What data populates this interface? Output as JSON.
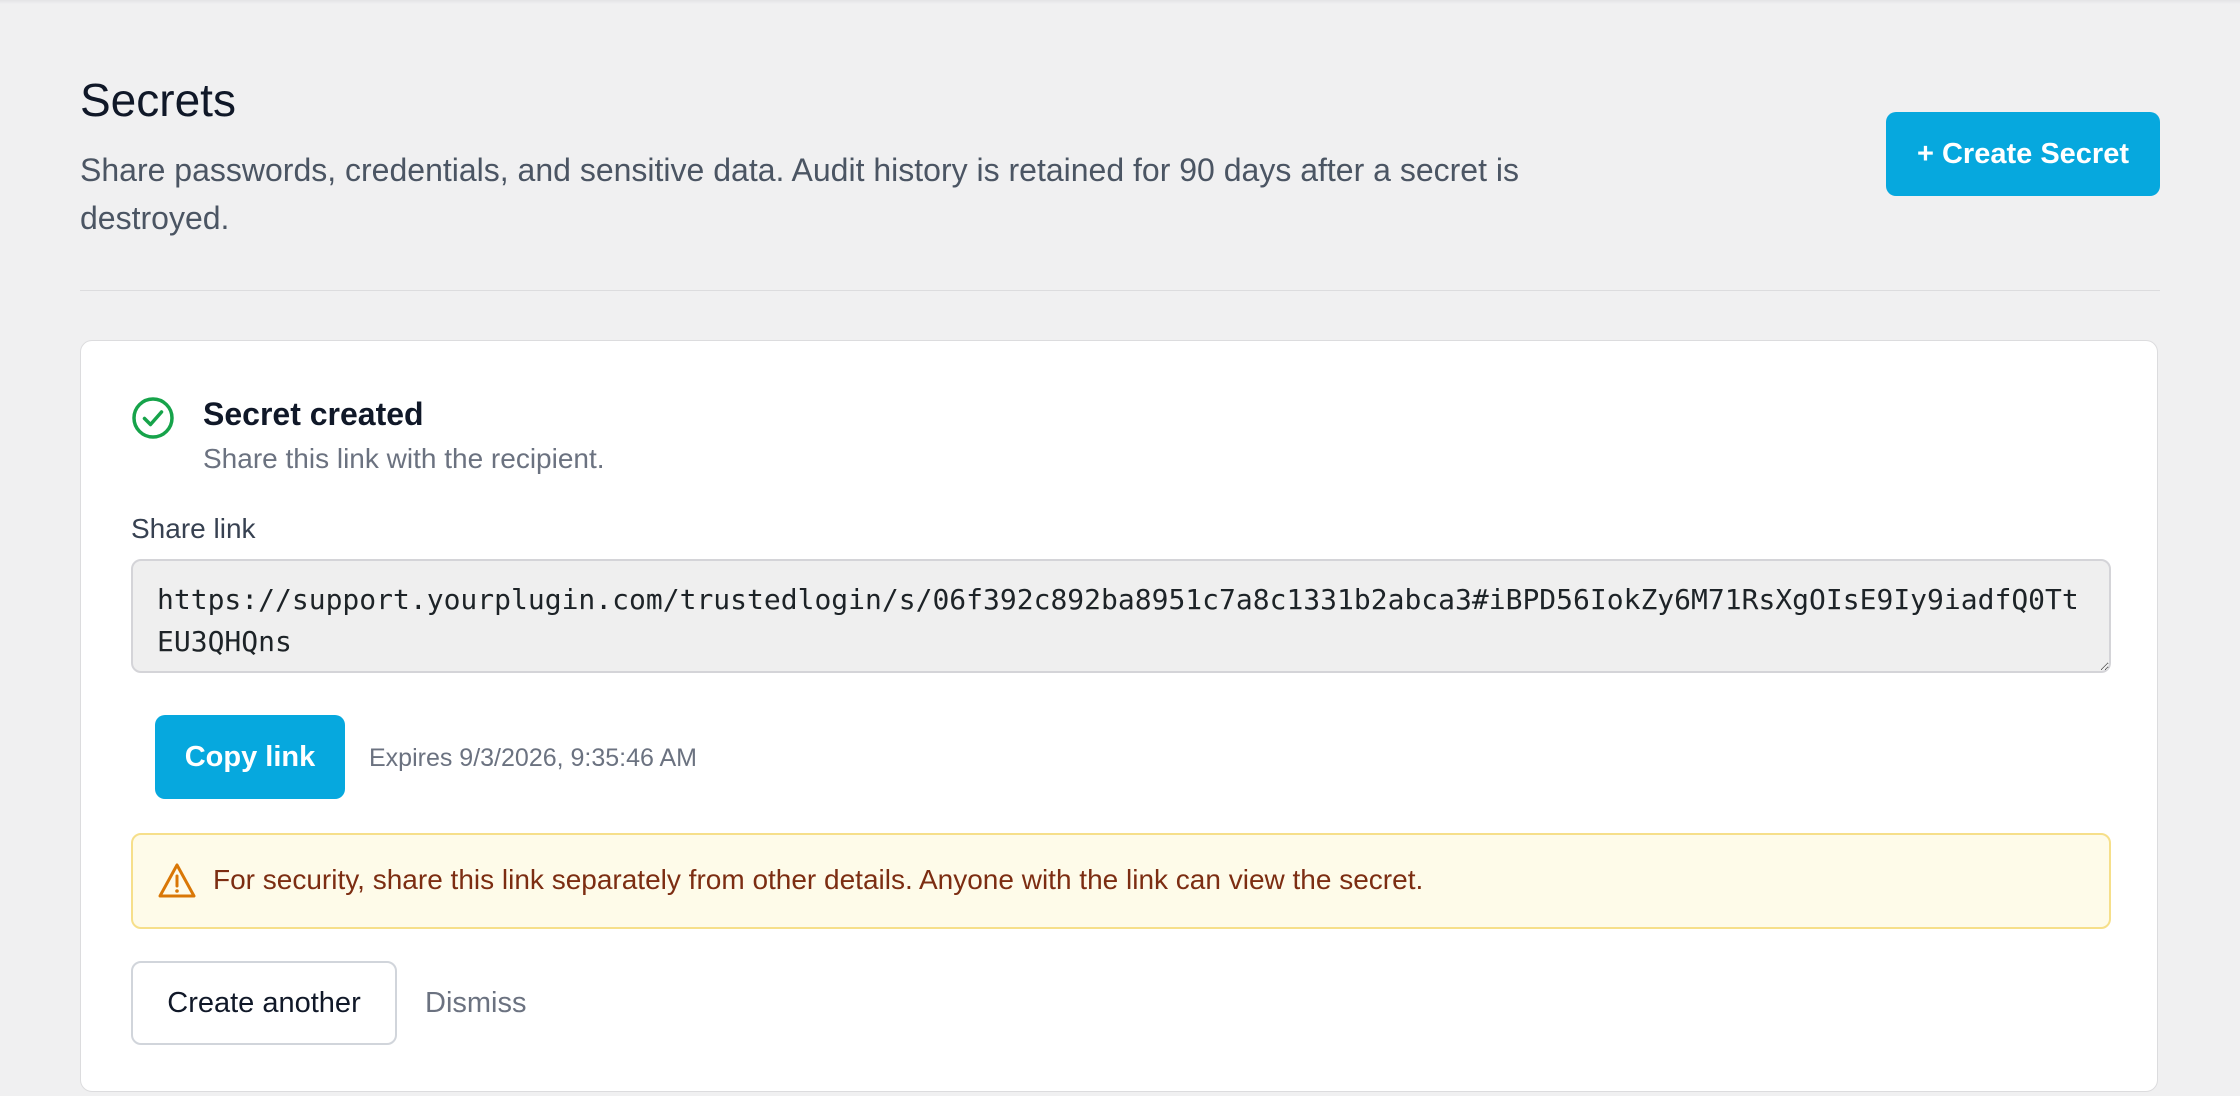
{
  "header": {
    "title": "Secrets",
    "description": "Share passwords, credentials, and sensitive data. Audit history is retained for 90 days after a secret is destroyed.",
    "create_button_label": "+ Create Secret"
  },
  "result": {
    "title": "Secret created",
    "subtitle": "Share this link with the recipient.",
    "share_label": "Share link",
    "share_link": "https://support.yourplugin.com/trustedlogin/s/06f392c892ba8951c7a8c1331b2abca3#iBPD56IokZy6M71RsXgOIsE9Iy9iadfQ0TtEU3QHQns",
    "copy_button_label": "Copy link",
    "expires_text": "Expires 9/3/2026, 9:35:46 AM",
    "warning_text": "For security, share this link separately from other details. Anyone with the link can view the secret.",
    "create_another_label": "Create another",
    "dismiss_label": "Dismiss"
  },
  "icons": {
    "success": "check-circle-icon",
    "warning": "warning-triangle-icon"
  },
  "colors": {
    "accent": "#06a8de",
    "success": "#16a34a",
    "warning_icon": "#d97706",
    "warning_bg": "#fefbe9",
    "warning_border": "#f6df8a",
    "warning_text": "#7c2d12"
  }
}
